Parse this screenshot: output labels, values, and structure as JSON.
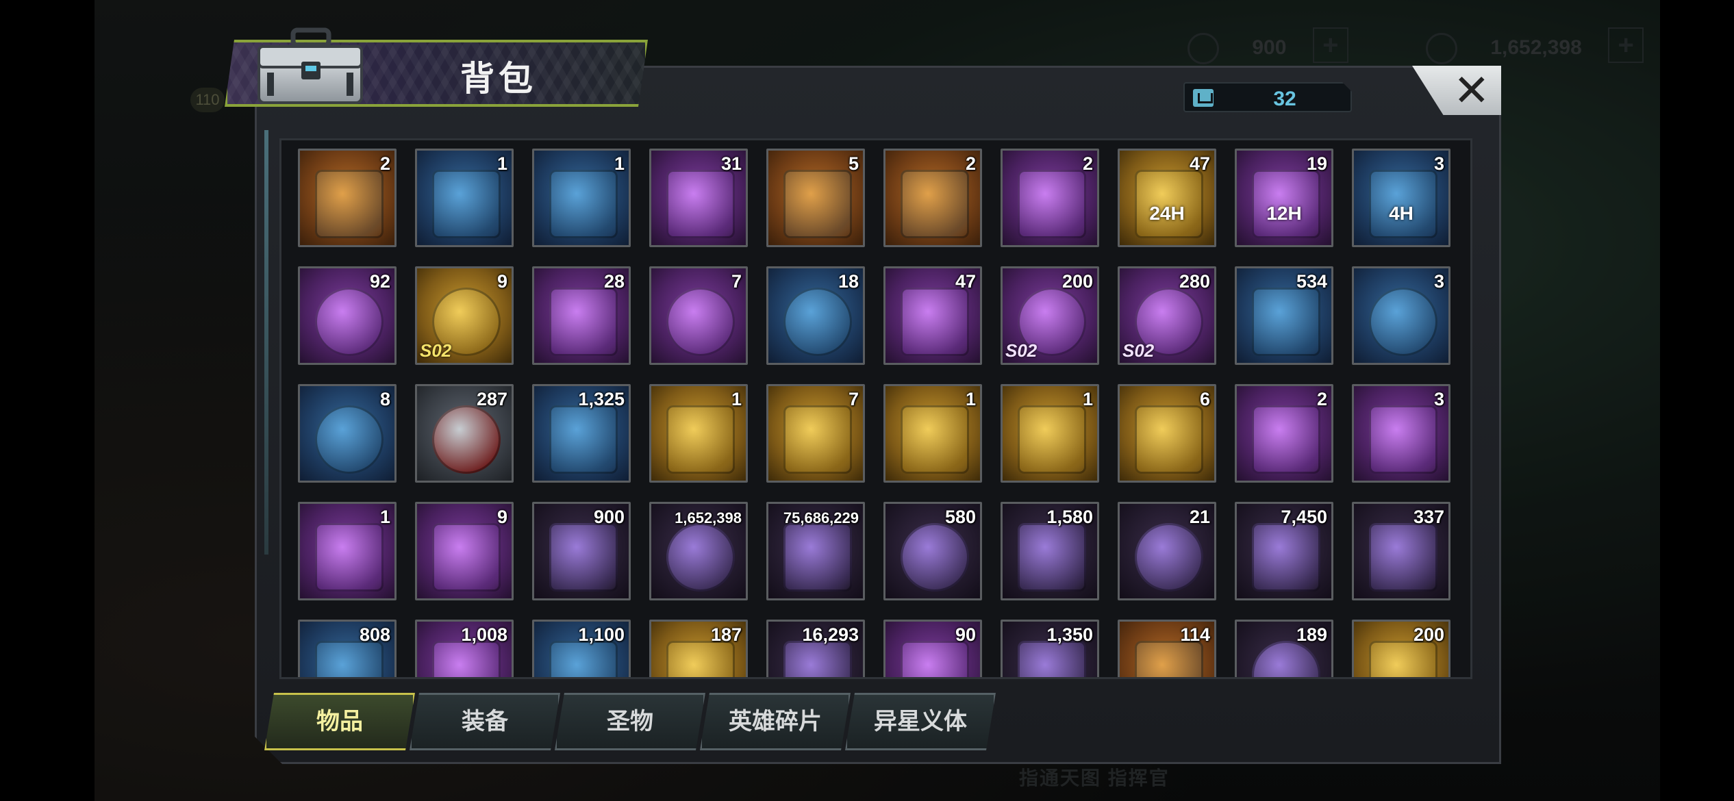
{
  "background": {
    "resources": [
      {
        "icon": "gear-hex-icon",
        "value": "900"
      },
      {
        "icon": "coin-icon",
        "value": "1,652,398"
      }
    ],
    "level": "110",
    "bottom_text": "指通天图 指挥官"
  },
  "panel": {
    "title": "背包",
    "capacity_icon": "bag-icon",
    "capacity": "32",
    "close_label": "✕"
  },
  "items": [
    {
      "icon": "orange-chest-icon",
      "count": "2",
      "rarity": "orange"
    },
    {
      "icon": "money-chest-icon",
      "count": "1",
      "rarity": "blue"
    },
    {
      "icon": "tier-iv-crate-icon",
      "count": "1",
      "rarity": "blue"
    },
    {
      "icon": "refresh-device-icon",
      "count": "31",
      "rarity": "purple"
    },
    {
      "icon": "gem-crate-icon",
      "count": "5",
      "rarity": "orange"
    },
    {
      "icon": "mystery-chest-icon",
      "count": "2",
      "rarity": "orange"
    },
    {
      "icon": "purple-chest-icon",
      "count": "2",
      "rarity": "purple"
    },
    {
      "icon": "speedup-24h-icon",
      "count": "47",
      "rarity": "gold",
      "tag": "24H"
    },
    {
      "icon": "speedup-12h-icon",
      "count": "19",
      "rarity": "purple",
      "tag": "12H"
    },
    {
      "icon": "speedup-4h-icon",
      "count": "3",
      "rarity": "blue",
      "tag": "4H"
    },
    {
      "icon": "red-bottle-cap-icon",
      "count": "92",
      "rarity": "purple"
    },
    {
      "icon": "bonus-gold-coin-icon",
      "count": "9",
      "rarity": "gold",
      "badge": "S02"
    },
    {
      "icon": "film-reel-icon",
      "count": "28",
      "rarity": "purple"
    },
    {
      "icon": "purple-cap-icon",
      "count": "7",
      "rarity": "purple"
    },
    {
      "icon": "spade-chip-icon",
      "count": "18",
      "rarity": "blue"
    },
    {
      "icon": "police-badge-icon",
      "count": "47",
      "rarity": "purple"
    },
    {
      "icon": "bonus-silver-coin-icon",
      "count": "200",
      "rarity": "purple",
      "badge": "S02"
    },
    {
      "icon": "spade-token-icon",
      "count": "280",
      "rarity": "purple",
      "badge": "S02"
    },
    {
      "icon": "cinema-ticket-icon",
      "count": "534",
      "rarity": "blue"
    },
    {
      "icon": "timer-coin-icon",
      "count": "3",
      "rarity": "blue"
    },
    {
      "icon": "blue-cap-icon",
      "count": "8",
      "rarity": "blue"
    },
    {
      "icon": "poker-chip-icon",
      "count": "287",
      "rarity": "gray"
    },
    {
      "icon": "bullet-icon",
      "count": "1,325",
      "rarity": "blue"
    },
    {
      "icon": "shirt-blueprint-icon",
      "count": "1",
      "rarity": "gold"
    },
    {
      "icon": "weapon-blueprint-icon",
      "count": "7",
      "rarity": "gold"
    },
    {
      "icon": "boots-blueprint-icon",
      "count": "1",
      "rarity": "gold"
    },
    {
      "icon": "hat-blueprint-icon",
      "count": "1",
      "rarity": "gold"
    },
    {
      "icon": "pistol-blueprint-icon",
      "count": "6",
      "rarity": "gold"
    },
    {
      "icon": "glasses-blueprint-icon",
      "count": "2",
      "rarity": "purple"
    },
    {
      "icon": "boots-blueprint-purple-icon",
      "count": "3",
      "rarity": "purple"
    },
    {
      "icon": "hat-blueprint-purple-icon",
      "count": "1",
      "rarity": "purple"
    },
    {
      "icon": "shirt-blueprint-purple-icon",
      "count": "9",
      "rarity": "purple"
    },
    {
      "icon": "purple-crystal-icon",
      "count": "900",
      "rarity": "dark"
    },
    {
      "icon": "coin-stack-icon",
      "count": "1,652,398",
      "rarity": "dark"
    },
    {
      "icon": "green-battery-icon",
      "count": "75,686,229",
      "rarity": "dark"
    },
    {
      "icon": "purple-orb-icon",
      "count": "580",
      "rarity": "dark"
    },
    {
      "icon": "gear-part-icon",
      "count": "1,580",
      "rarity": "dark"
    },
    {
      "icon": "red-node-icon",
      "count": "21",
      "rarity": "dark"
    },
    {
      "icon": "eye-scroll-icon",
      "count": "7,450",
      "rarity": "dark"
    },
    {
      "icon": "alien-shard-icon",
      "count": "337",
      "rarity": "dark"
    },
    {
      "icon": "gauntlet-icon",
      "count": "808",
      "rarity": "blue"
    },
    {
      "icon": "puzzle-piece-icon",
      "count": "1,008",
      "rarity": "purple"
    },
    {
      "icon": "blue-book-icon",
      "count": "1,100",
      "rarity": "blue"
    },
    {
      "icon": "gold-book-icon",
      "count": "187",
      "rarity": "gold"
    },
    {
      "icon": "red-swirl-icon",
      "count": "16,293",
      "rarity": "dark"
    },
    {
      "icon": "lightning-icon",
      "count": "90",
      "rarity": "purple"
    },
    {
      "icon": "pink-crystal-icon",
      "count": "1,350",
      "rarity": "dark"
    },
    {
      "icon": "orange-fist-icon",
      "count": "114",
      "rarity": "orange"
    },
    {
      "icon": "red-target-icon",
      "count": "189",
      "rarity": "dark"
    },
    {
      "icon": "gold-relic-icon",
      "count": "200",
      "rarity": "gold"
    }
  ],
  "tabs": [
    {
      "label": "物品",
      "active": true
    },
    {
      "label": "装备",
      "active": false
    },
    {
      "label": "圣物",
      "active": false
    },
    {
      "label": "英雄碎片",
      "active": false
    },
    {
      "label": "异星义体",
      "active": false
    }
  ],
  "colors": {
    "panel_bg": "#1a1c20",
    "title_border": "#8aa33a",
    "capacity_text": "#68c4e0",
    "active_tab_border": "#c8c24b",
    "rarity": {
      "orange": "#b46a26",
      "blue": "#35689a",
      "purple": "#7c3c9c",
      "gold": "#c99a2f",
      "gray": "#5f6670",
      "dark": "#3b2d4a"
    }
  }
}
